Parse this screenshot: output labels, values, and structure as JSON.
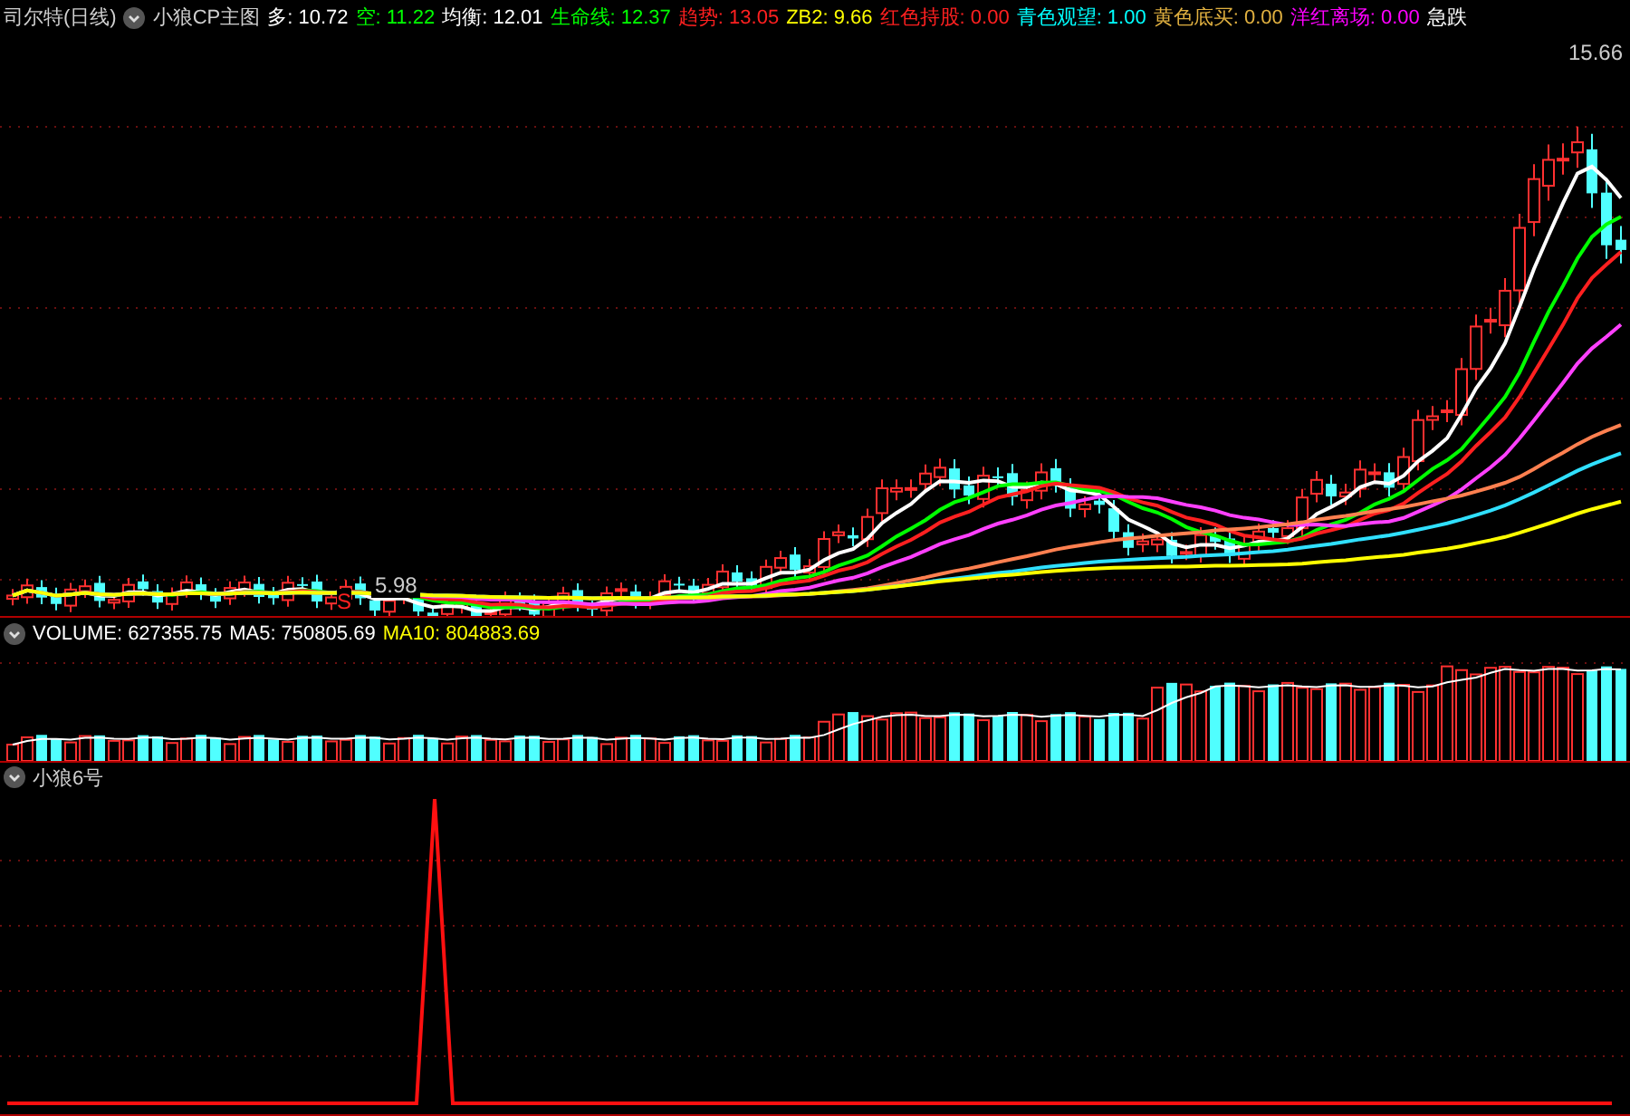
{
  "chart_title": "司尔特(日线)",
  "main_indicator": {
    "name": "小狼CP主图",
    "values": [
      {
        "label": "多:",
        "value": "10.72",
        "color": "#ffffff"
      },
      {
        "label": "空:",
        "value": "11.22",
        "color": "#00ff00"
      },
      {
        "label": "均衡:",
        "value": "12.01",
        "color": "#ffffff"
      },
      {
        "label": "生命线:",
        "value": "12.37",
        "color": "#00ff00"
      },
      {
        "label": "趋势:",
        "value": "13.05",
        "color": "#ff2020"
      },
      {
        "label": "ZB2:",
        "value": "9.66",
        "color": "#ffff00"
      },
      {
        "label": "红色持股:",
        "value": "0.00",
        "color": "#ff2020"
      },
      {
        "label": "青色观望:",
        "value": "1.00",
        "color": "#00ffff"
      },
      {
        "label": "黄色底买:",
        "value": "0.00",
        "color": "#e0b040"
      },
      {
        "label": "洋红离场:",
        "value": "0.00",
        "color": "#ff00ff"
      },
      {
        "label": "急跌",
        "color": "#ffffff"
      }
    ]
  },
  "price_labels": {
    "high": "15.66",
    "low": "5.98"
  },
  "signal_mark": "S",
  "volume_indicator": {
    "values": [
      {
        "label": "VOLUME:",
        "value": "627355.75",
        "color": "#ffffff"
      },
      {
        "label": "MA5:",
        "value": "750805.69",
        "color": "#ffffff"
      },
      {
        "label": "MA10:",
        "value": "804883.69",
        "color": "#ffff00"
      }
    ]
  },
  "sub_indicator": {
    "name": "小狼6号"
  }
}
